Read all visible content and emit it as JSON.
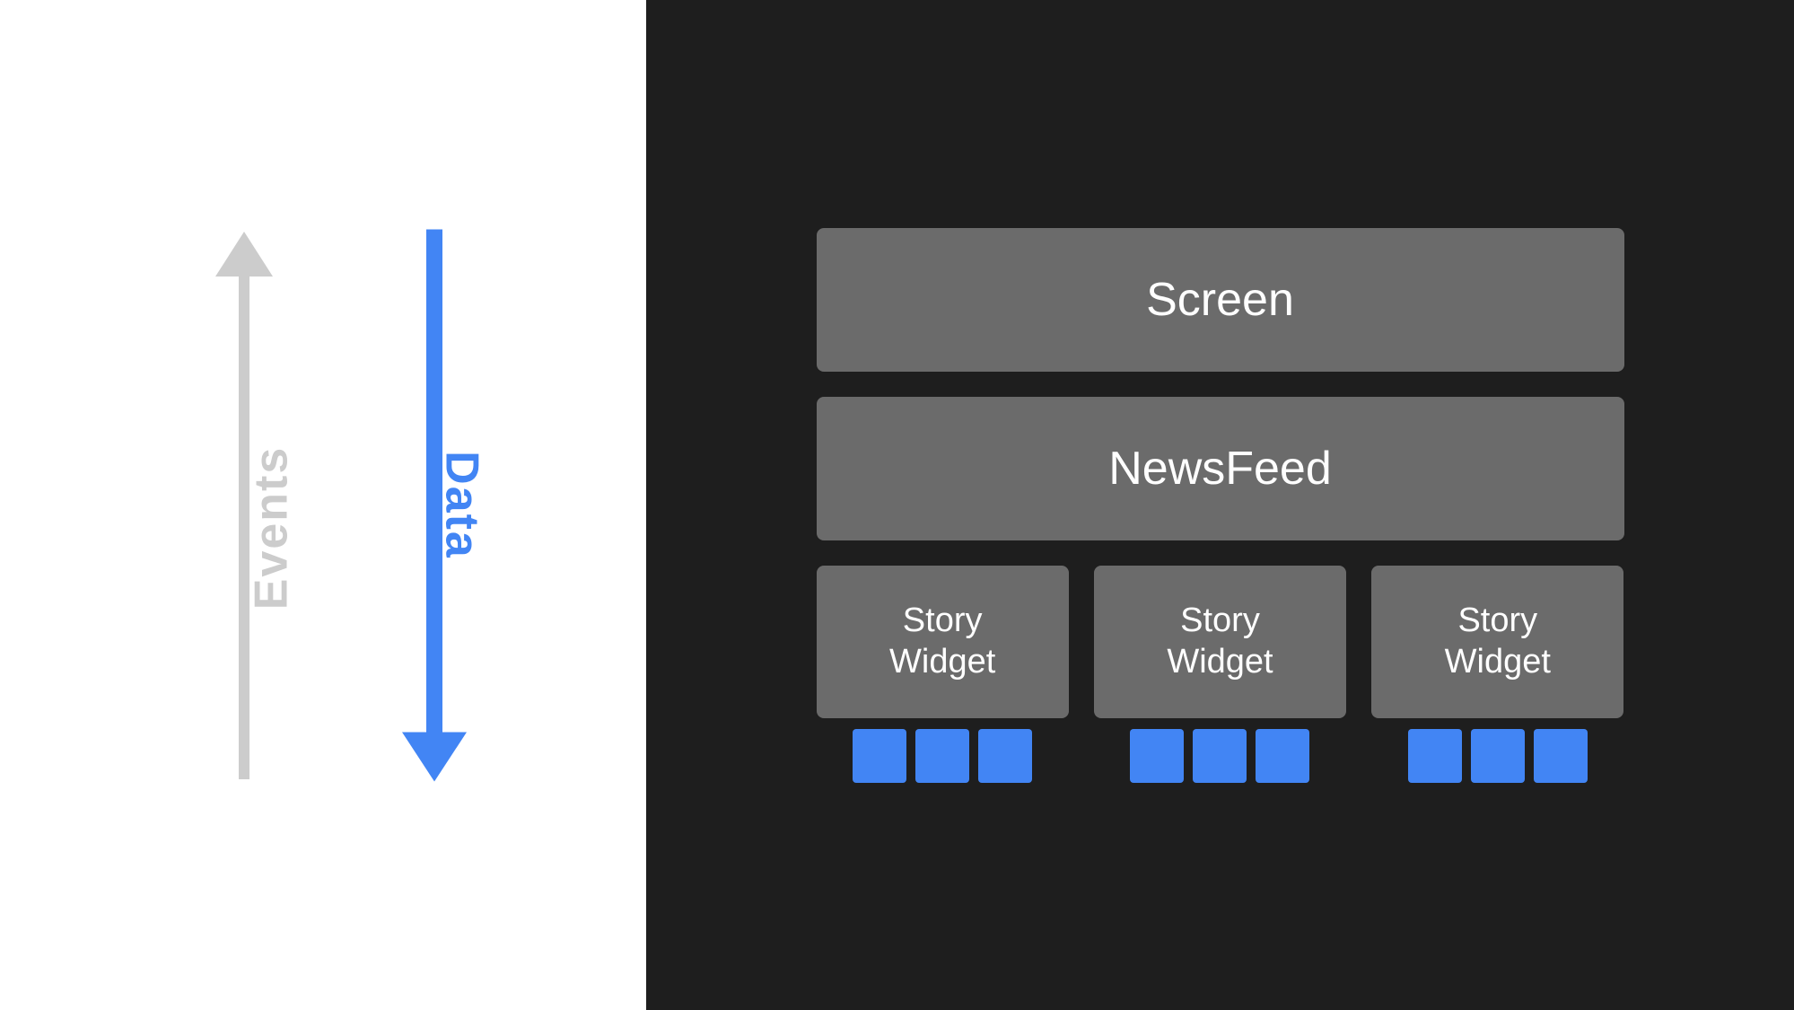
{
  "left_panel": {
    "events_label": "Events",
    "data_label": "Data"
  },
  "right_panel": {
    "screen_label": "Screen",
    "newsfeed_label": "NewsFeed",
    "story_widgets": [
      {
        "label": "Story\nWidget",
        "subitems": 3
      },
      {
        "label": "Story\nWidget",
        "subitems": 3
      },
      {
        "label": "Story\nWidget",
        "subitems": 3
      }
    ]
  },
  "colors": {
    "blue": "#4285f4",
    "gray_box": "#6b6b6b",
    "dark_bg": "#1e1e1e",
    "white_bg": "#ffffff",
    "arrow_gray": "#cccccc"
  }
}
